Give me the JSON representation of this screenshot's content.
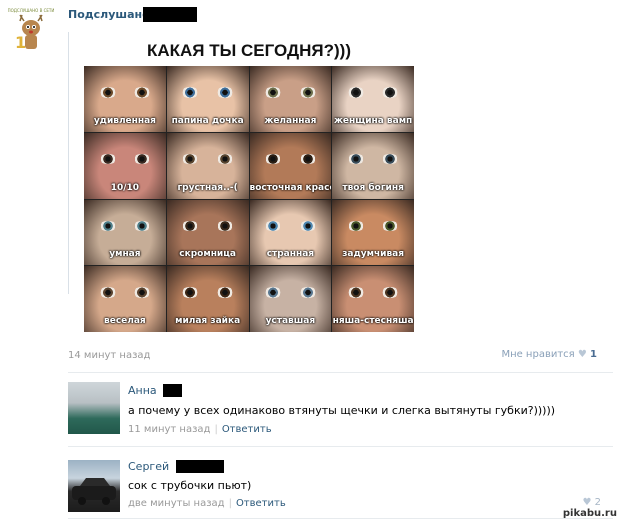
{
  "post": {
    "group_name": "Подслушано",
    "time": "14 минут назад",
    "like_label": "Мне нравится",
    "like_count": "1",
    "image": {
      "title": "КАКАЯ ТЫ СЕГОДНЯ?)))",
      "cells": [
        {
          "label": "удивленная",
          "skin": "#d9a98b",
          "eye": "#6b4a2a"
        },
        {
          "label": "папина дочка",
          "skin": "#e8c2a6",
          "eye": "#3f6e9a"
        },
        {
          "label": "желанная",
          "skin": "#c99f87",
          "eye": "#6d6f4c"
        },
        {
          "label": "женщина вамп",
          "skin": "#e9d3c4",
          "eye": "#2a2a2a"
        },
        {
          "label": "10/10",
          "skin": "#c9867a",
          "eye": "#3b2a22"
        },
        {
          "label": "грустная..-(",
          "skin": "#d7b39a",
          "eye": "#5a4630"
        },
        {
          "label": "восточная красотка",
          "skin": "#b27a58",
          "eye": "#2d1f14"
        },
        {
          "label": "твоя богиня",
          "skin": "#cfb7a3",
          "eye": "#3a4e5c"
        },
        {
          "label": "умная",
          "skin": "#c6ad97",
          "eye": "#4e7f8a"
        },
        {
          "label": "скромница",
          "skin": "#a8755a",
          "eye": "#3a2a1c"
        },
        {
          "label": "странная",
          "skin": "#e7c8b1",
          "eye": "#4f87b0"
        },
        {
          "label": "задумчивая",
          "skin": "#c98a62",
          "eye": "#4b5a2a"
        },
        {
          "label": "веселая",
          "skin": "#d5a88a",
          "eye": "#5b4430"
        },
        {
          "label": "милая зайка",
          "skin": "#b9805d",
          "eye": "#3a2515"
        },
        {
          "label": "уставшая",
          "skin": "#c7b2a4",
          "eye": "#5a7890"
        },
        {
          "label": "няша-стесняша",
          "skin": "#c98f73",
          "eye": "#4a3421"
        }
      ]
    }
  },
  "comments": [
    {
      "name": "Анна",
      "text": "а почему у всех одинаково втянуты щечки и слегка вытянуты губки?)))))",
      "time": "11 минут назад",
      "reply": "Ответить"
    },
    {
      "name": "Сергей",
      "text": "сок с трубочки пьют)",
      "time": "две минуты назад",
      "reply": "Ответить",
      "like_count": "2"
    }
  ],
  "watermark": "pikabu.ru",
  "colors": {
    "link": "#2b587a",
    "muted": "#999999",
    "divider": "#e7ebee"
  }
}
